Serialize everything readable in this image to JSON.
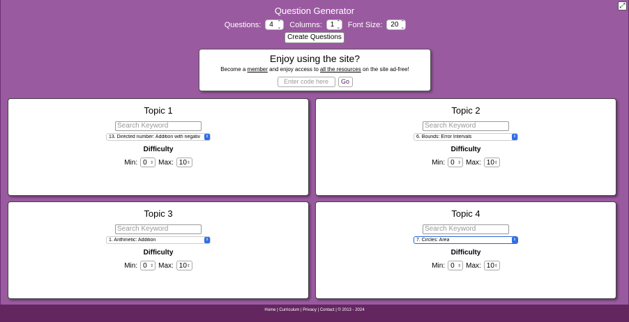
{
  "app": {
    "title": "Question Generator"
  },
  "controls": {
    "questions_label": "Questions:",
    "questions_value": "4",
    "columns_label": "Columns:",
    "columns_value": "1",
    "font_size_label": "Font Size:",
    "font_size_value": "20",
    "create_button": "Create Questions"
  },
  "promo": {
    "heading": "Enjoy using the site?",
    "text_before": "Become a ",
    "member_link": "member",
    "text_middle": " and enjoy access to ",
    "resources_link": "all the resources",
    "text_after": " on the site ad-free!",
    "code_placeholder": "Enter code here",
    "go_button": "Go"
  },
  "topics": [
    {
      "title": "Topic 1",
      "search_placeholder": "Search Keyword",
      "selected": "13. Directed number: Addition with negativ",
      "difficulty_label": "Difficulty",
      "min_label": "Min:",
      "min_value": "0",
      "max_label": "Max:",
      "max_value": "10"
    },
    {
      "title": "Topic 2",
      "search_placeholder": "Search Keyword",
      "selected": "6. Bounds: Error Intervals",
      "difficulty_label": "Difficulty",
      "min_label": "Min:",
      "min_value": "0",
      "max_label": "Max:",
      "max_value": "10"
    },
    {
      "title": "Topic 3",
      "search_placeholder": "Search Keyword",
      "selected": "1. Arithmetic: Addition",
      "difficulty_label": "Difficulty",
      "min_label": "Min:",
      "min_value": "0",
      "max_label": "Max:",
      "max_value": "10"
    },
    {
      "title": "Topic 4",
      "search_placeholder": "Search Keyword",
      "selected": "7. Circles: Area",
      "difficulty_label": "Difficulty",
      "min_label": "Min:",
      "min_value": "0",
      "max_label": "Max:",
      "max_value": "10"
    }
  ],
  "footer": {
    "home": "Home",
    "curriculum": "Curriculum",
    "privacy": "Privacy",
    "contact": "Contact",
    "copyright": "© 2013 - 2024",
    "separator": " | "
  },
  "icons": {
    "fullscreen": "fullscreen-icon",
    "spinner": "spinner-arrows-icon",
    "dropdown": "dropdown-chevron-icon"
  },
  "colors": {
    "background": "#9a5aa0",
    "footer": "#63265f",
    "select_accent": "#2f6ee8"
  }
}
